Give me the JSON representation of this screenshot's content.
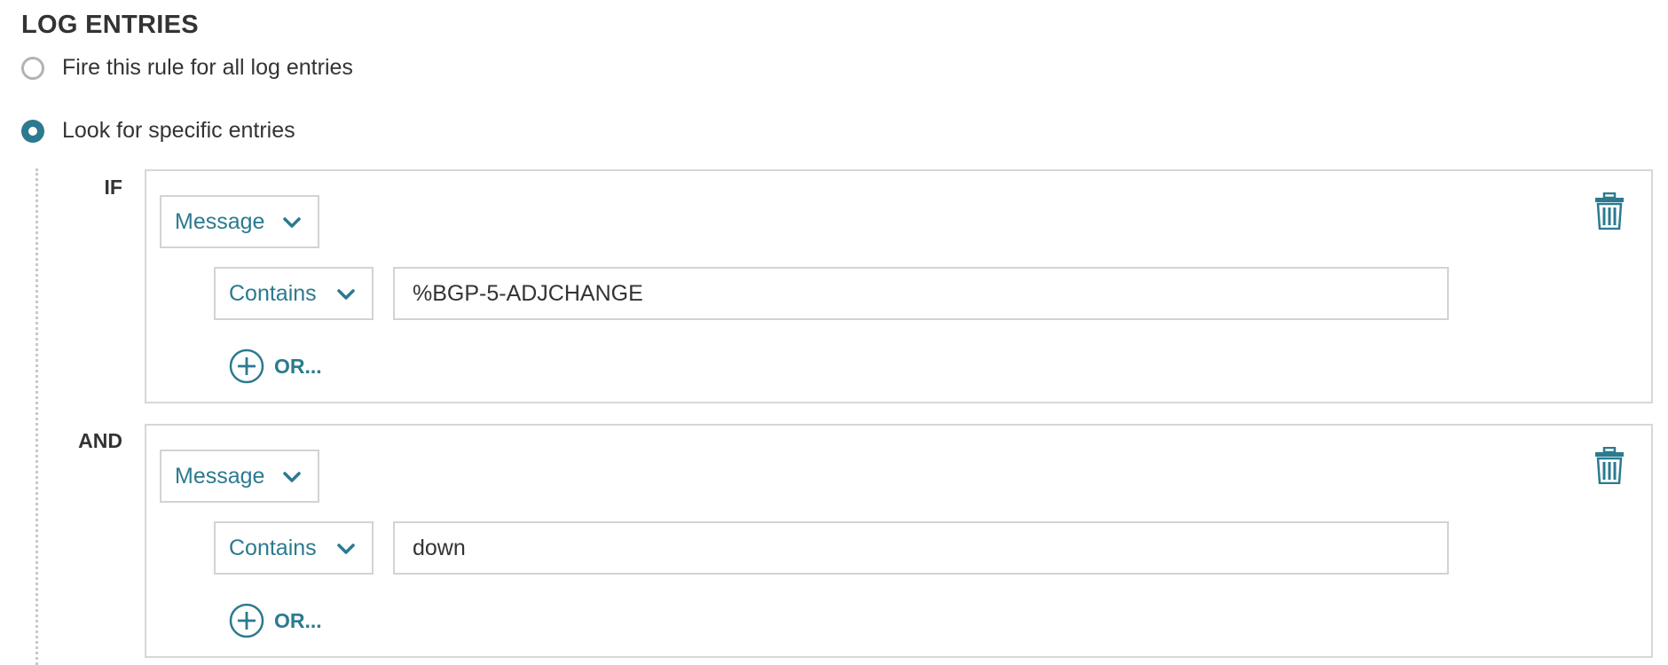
{
  "section_title": "LOG ENTRIES",
  "radio_options": [
    {
      "label": "Fire this rule for all log entries",
      "checked": false
    },
    {
      "label": "Look for specific entries",
      "checked": true
    }
  ],
  "conditions": [
    {
      "connector": "IF",
      "field": "Message",
      "operator": "Contains",
      "value": "%BGP-5-ADJCHANGE",
      "or_label": "OR..."
    },
    {
      "connector": "AND",
      "field": "Message",
      "operator": "Contains",
      "value": "down",
      "or_label": "OR..."
    }
  ],
  "icons": {
    "radio_unchecked": "radio-unchecked-icon",
    "radio_checked": "radio-checked-icon",
    "chevron": "chevron-down-icon",
    "add": "plus-circle-icon",
    "delete": "trash-icon"
  },
  "colors": {
    "accent": "#2b7a8f",
    "text": "#333333",
    "border": "#d3d3d3",
    "radio_border": "#b3b3b3"
  }
}
